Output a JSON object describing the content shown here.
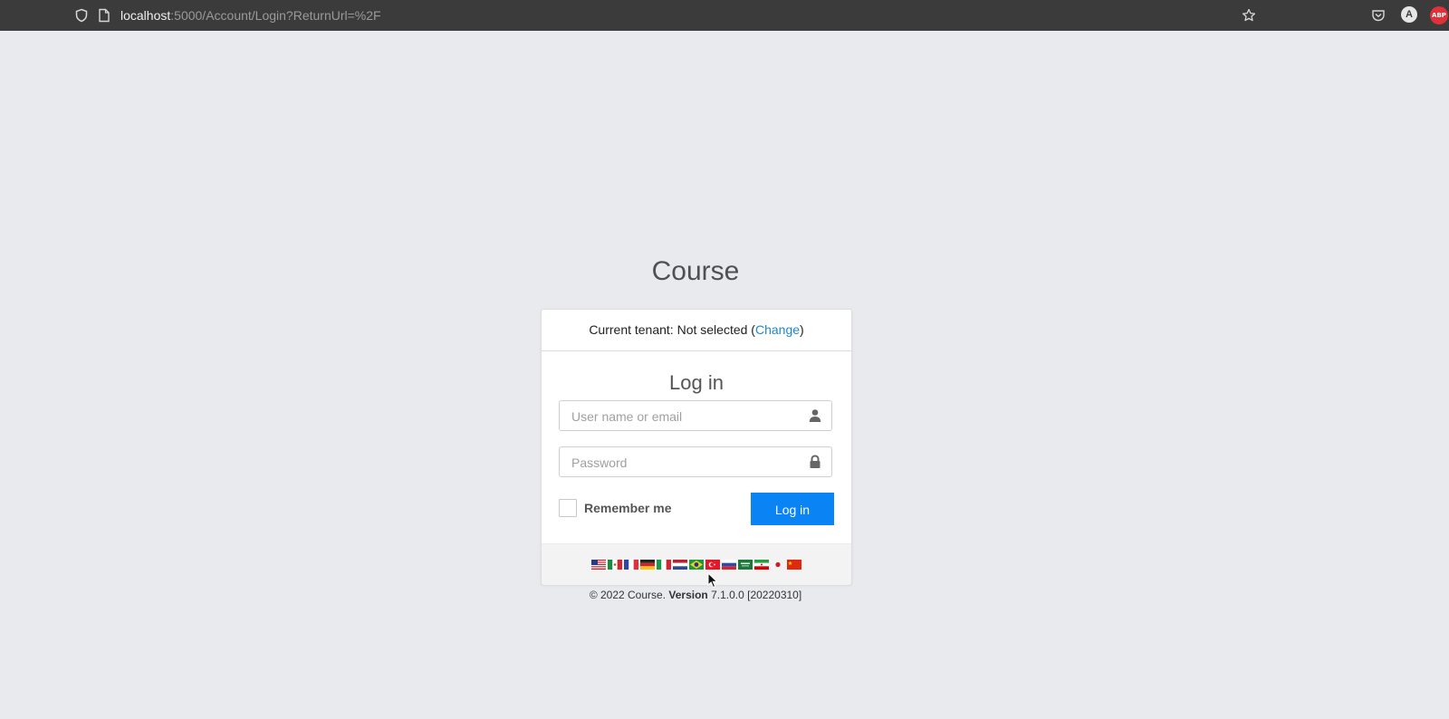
{
  "browser": {
    "url_host": "localhost",
    "url_rest": ":5000/Account/Login?ReturnUrl=%2F",
    "account_initial": "A",
    "adblock_label": "ABP"
  },
  "page": {
    "brand": "Course"
  },
  "login_card": {
    "tenant_prefix": "Current tenant: Not selected (",
    "tenant_change": "Change",
    "tenant_suffix": ")",
    "title": "Log in",
    "username_placeholder": "User name or email",
    "password_placeholder": "Password",
    "remember_me": "Remember me",
    "login_button": "Log in"
  },
  "languages": [
    {
      "name": "flag-us-icon"
    },
    {
      "name": "flag-mx-icon"
    },
    {
      "name": "flag-fr-icon"
    },
    {
      "name": "flag-de-icon"
    },
    {
      "name": "flag-it-icon"
    },
    {
      "name": "flag-nl-icon"
    },
    {
      "name": "flag-br-icon"
    },
    {
      "name": "flag-tr-icon"
    },
    {
      "name": "flag-ru-icon"
    },
    {
      "name": "flag-sa-icon"
    },
    {
      "name": "flag-ir-icon"
    },
    {
      "name": "flag-jp-icon"
    },
    {
      "name": "flag-cn-icon"
    }
  ],
  "footer": {
    "copyright": "© 2022 Course.",
    "version_label": "Version",
    "version_value": "7.1.0.0 [20220310]"
  },
  "colors": {
    "accent": "#0a84f5",
    "link": "#1e88c7",
    "background": "#e9eaee"
  }
}
